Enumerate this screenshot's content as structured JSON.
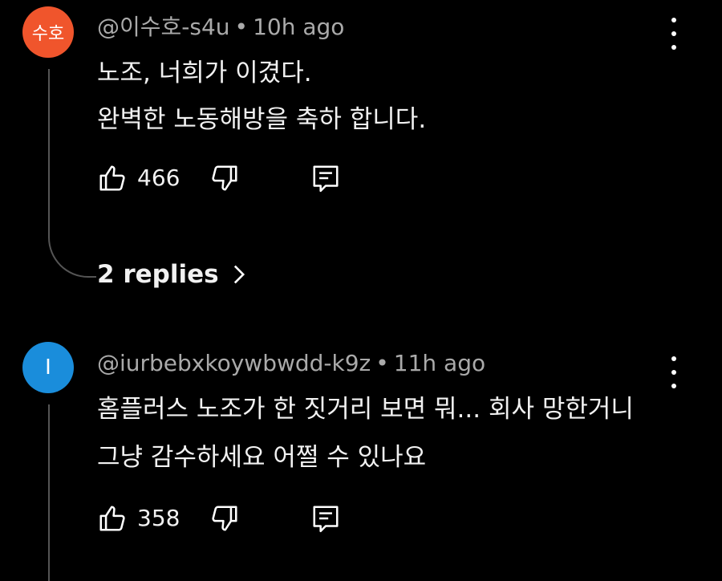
{
  "comments": [
    {
      "avatar_text": "수호",
      "avatar_color": "#f0552c",
      "author": "@이수호-s4u",
      "separator": "•",
      "time": "10h ago",
      "lines": [
        "노조, 너희가 이겼다.",
        "완벽한 노동해방을 축하 합니다."
      ],
      "likes": "466",
      "replies_label": "2 replies"
    },
    {
      "avatar_text": "I",
      "avatar_color": "#1a8ddb",
      "author": "@iurbebxkoywbwdd-k9z",
      "separator": "•",
      "time": "11h ago",
      "lines": [
        "홈플러스 노조가 한 짓거리 보면 뭐... 회사 망한거니",
        "그냥 감수하세요 어쩔 수 있나요"
      ],
      "likes": "358"
    }
  ],
  "icons": {
    "like": "thumbs-up-icon",
    "dislike": "thumbs-down-icon",
    "reply": "comment-reply-icon",
    "more": "more-vertical-icon",
    "chevron": "chevron-right-icon"
  }
}
